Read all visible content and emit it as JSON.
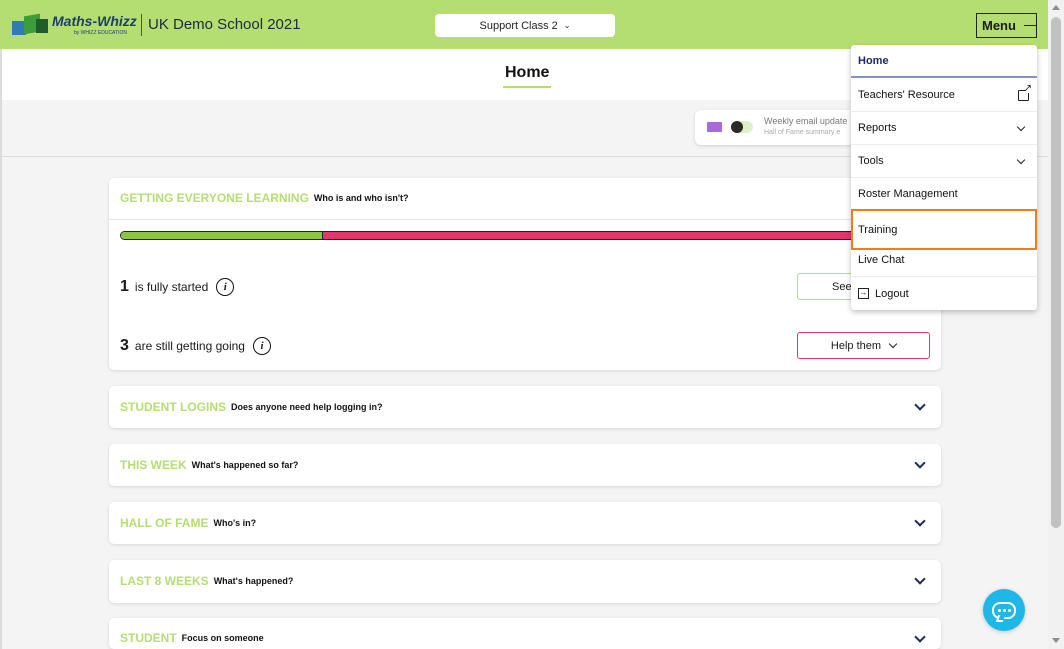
{
  "header": {
    "logo_brand": "Maths-Whizz",
    "logo_sub": "by WHIZZ EDUCATION",
    "school_name": "UK Demo School 2021",
    "class_select": "Support Class 2",
    "menu_label": "Menu"
  },
  "page": {
    "title": "Home"
  },
  "email_widget": {
    "title": "Weekly email update",
    "subtitle": "Hall of Fame summary e"
  },
  "getting_everyone_learning": {
    "keyword": "GETTING EVERYONE LEARNING",
    "question": "Who is and who isn't?",
    "progress_fraction_started": 0.25,
    "fully_started_count": "1",
    "fully_started_text": "is fully started",
    "still_going_count": "3",
    "still_going_text": "are still getting going",
    "see_button": "See",
    "help_button": "Help them"
  },
  "sections": [
    {
      "keyword": "STUDENT LOGINS",
      "question": "Does anyone need help logging in?"
    },
    {
      "keyword": "THIS WEEK",
      "question": "What's happened so far?"
    },
    {
      "keyword": "HALL OF FAME",
      "question": "Who's in?"
    },
    {
      "keyword": "LAST 8 WEEKS",
      "question": "What's happened?"
    },
    {
      "keyword": "STUDENT",
      "question": "Focus on someone"
    }
  ],
  "menu_items": [
    {
      "label": "Home",
      "icon": ""
    },
    {
      "label": "Teachers' Resource",
      "icon": "external-link-icon"
    },
    {
      "label": "Reports",
      "icon": "chevron-down-icon"
    },
    {
      "label": "Tools",
      "icon": "chevron-down-icon"
    },
    {
      "label": "Roster Management",
      "icon": ""
    },
    {
      "label": "Training",
      "icon": ""
    },
    {
      "label": "Live Chat",
      "icon": ""
    },
    {
      "label": "Logout",
      "icon": "logout-icon"
    }
  ],
  "colors": {
    "header_green": "#b5de72",
    "progress_green": "#8cc63f",
    "progress_red": "#e8336b",
    "highlight_orange": "#f07d16",
    "chat_blue": "#1db8e8",
    "email_purple": "#a86ad9"
  }
}
